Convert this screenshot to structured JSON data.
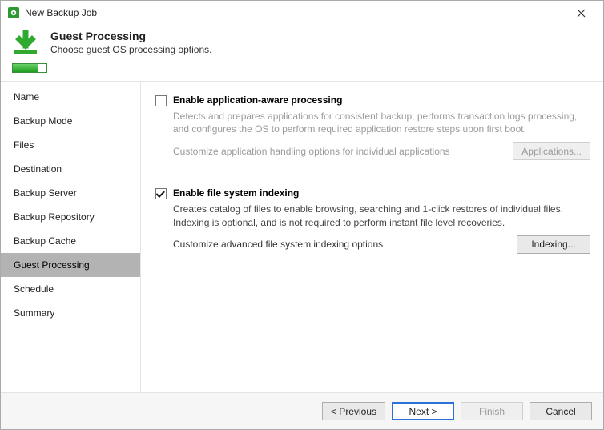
{
  "window": {
    "title": "New Backup Job"
  },
  "header": {
    "title": "Guest Processing",
    "subtitle": "Choose guest OS processing options."
  },
  "sidebar": {
    "items": [
      {
        "label": "Name"
      },
      {
        "label": "Backup Mode"
      },
      {
        "label": "Files"
      },
      {
        "label": "Destination"
      },
      {
        "label": "Backup Server"
      },
      {
        "label": "Backup Repository"
      },
      {
        "label": "Backup Cache"
      },
      {
        "label": "Guest Processing"
      },
      {
        "label": "Schedule"
      },
      {
        "label": "Summary"
      }
    ],
    "selected_index": 7
  },
  "appaware": {
    "checked": false,
    "title": "Enable application-aware processing",
    "desc": "Detects and prepares applications for consistent backup, performs transaction logs processing, and configures the OS to perform required application restore steps upon first boot.",
    "row_label": "Customize application handling options for individual applications",
    "button_label": "Applications..."
  },
  "indexing": {
    "checked": true,
    "title": "Enable file system indexing",
    "desc": "Creates catalog of files to enable browsing, searching and 1-click restores of individual files. Indexing is optional, and is not required to perform instant file level recoveries.",
    "row_label": "Customize advanced file system indexing options",
    "button_label": "Indexing..."
  },
  "footer": {
    "previous": "< Previous",
    "next": "Next >",
    "finish": "Finish",
    "cancel": "Cancel"
  }
}
